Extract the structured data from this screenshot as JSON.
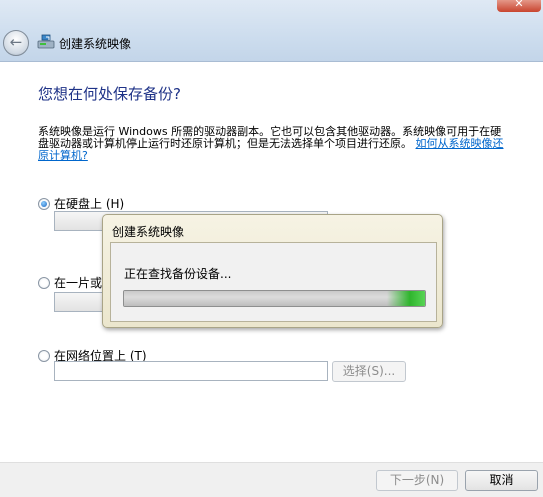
{
  "window": {
    "close_glyph": "✕",
    "back_glyph": "←",
    "title": "创建系统映像"
  },
  "main": {
    "heading": "您想在何处保存备份?",
    "description": "系统映像是运行 Windows 所需的驱动器副本。它也可以包含其他驱动器。系统映像可用于在硬盘驱动器或计算机停止运行时还原计算机；但是无法选择单个项目进行还原。",
    "help_link": "如何从系统映像还原计算机?"
  },
  "options": {
    "hard_disk": {
      "label": "在硬盘上 (H)",
      "selected": true
    },
    "dvd": {
      "label": "在一片或"
    },
    "network": {
      "label": "在网络位置上 (T)",
      "input_value": "",
      "select_button": "选择(S)..."
    }
  },
  "footer": {
    "next_button": "下一步(N)",
    "cancel_button": "取消"
  },
  "progress_dialog": {
    "title": "创建系统映像",
    "message": "正在查找备份设备...",
    "progress": 1.0
  },
  "colors": {
    "heading": "#1e3287",
    "link": "#0066cc",
    "progress_accent": "#2fb52d"
  }
}
